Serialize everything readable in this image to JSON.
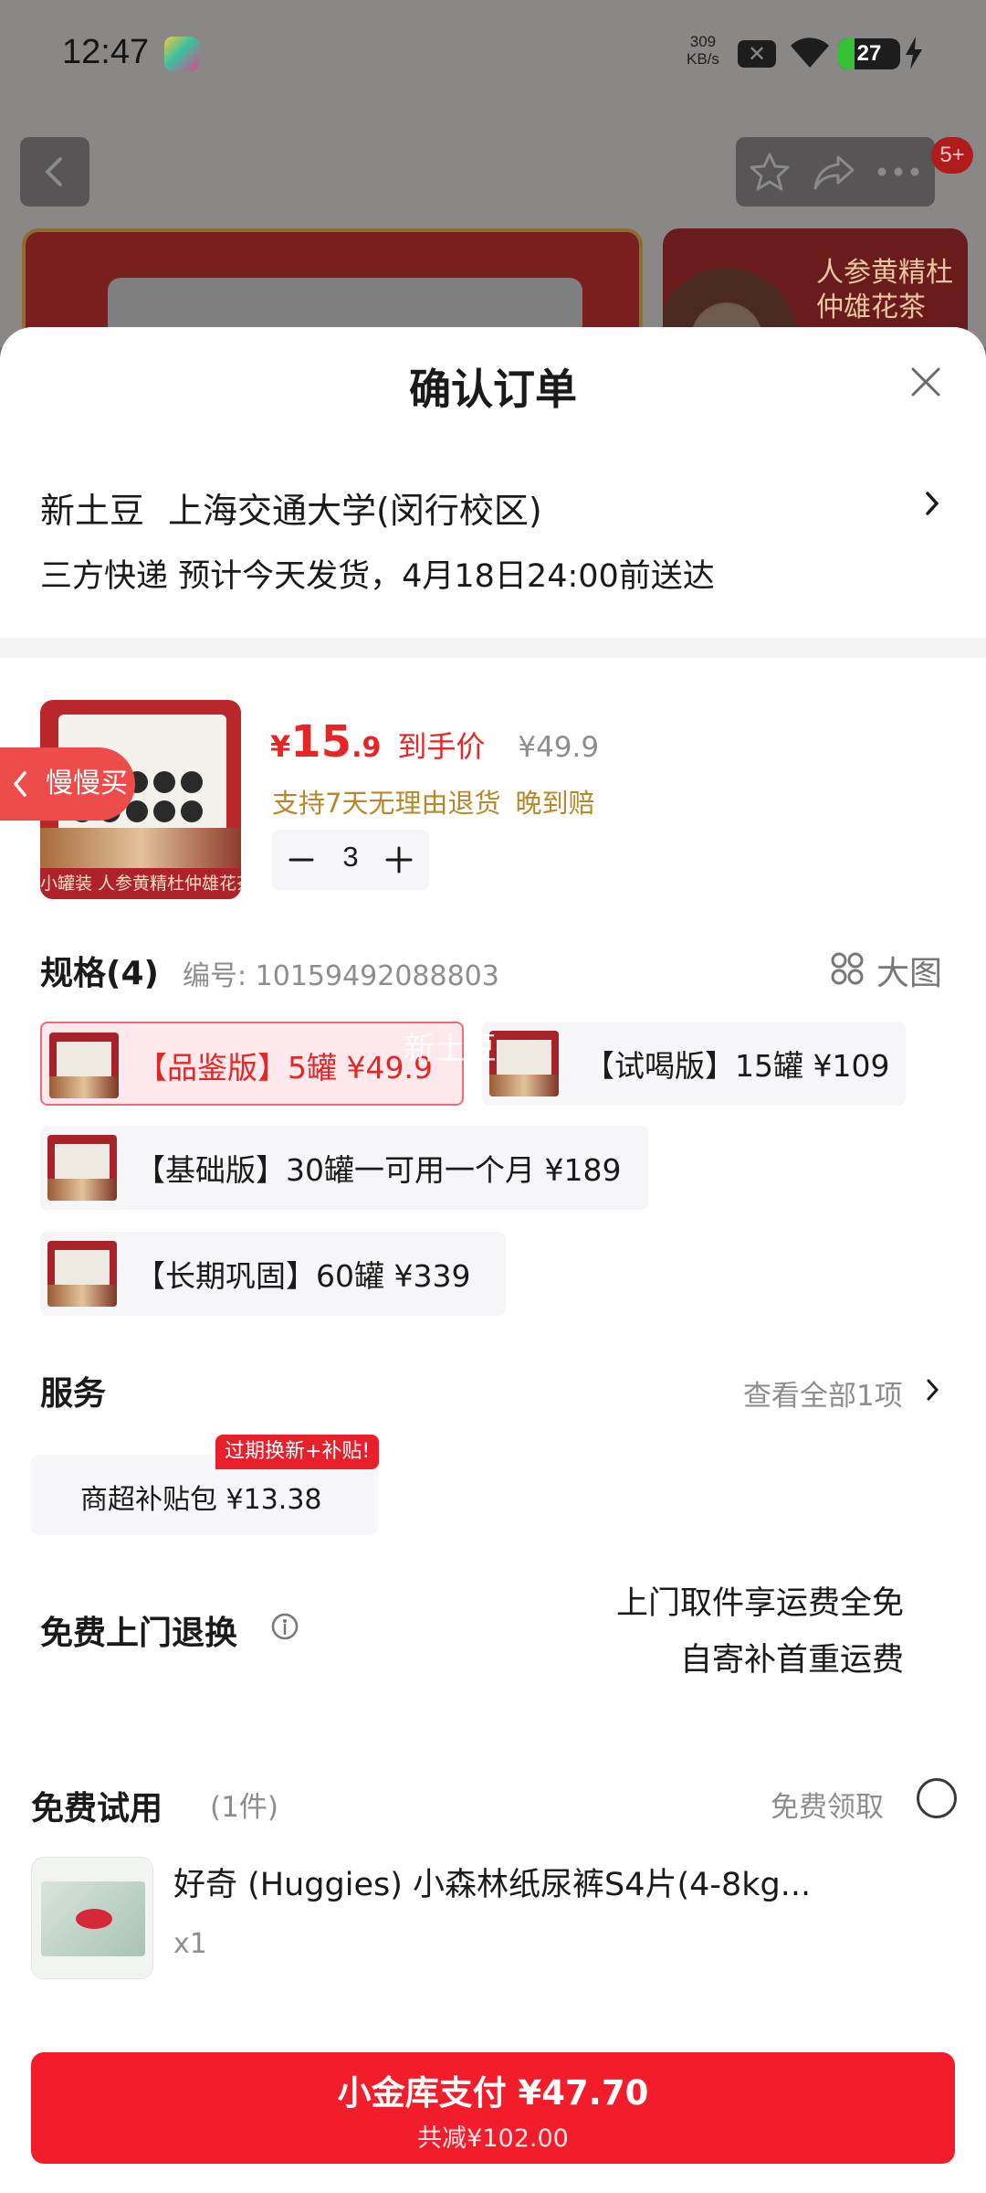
{
  "status_bar": {
    "time": "12:47",
    "net_speed_value": "309",
    "net_speed_unit": "KB/s",
    "battery_percent": "27",
    "battery_level": 0.27
  },
  "background": {
    "notification_badge": "5+",
    "banner_text": "人参黄精杜仲雄花茶"
  },
  "sheet": {
    "title": "确认订单"
  },
  "address": {
    "name": "新土豆",
    "location": "上海交通大学(闵行校区)",
    "shipping": "三方快递 预计今天发货，4月18日24:00前送达"
  },
  "product": {
    "image_label": "小罐装 人参黄精杜仲雄花茶",
    "slow_buy": "慢慢买",
    "price_currency": "¥",
    "price_int": "15",
    "price_dec": ".9",
    "price_tag": "到手价",
    "original_price": "¥49.9",
    "promise_1": "支持7天无理由退货",
    "promise_2": "晚到赔",
    "quantity": "3"
  },
  "spec": {
    "title": "规格(4)",
    "code": "编号: 10159492088803",
    "big_image": "大图",
    "watermark": "新土豆",
    "options": [
      {
        "text": "【品鉴版】5罐  ¥49.9",
        "selected": true
      },
      {
        "text": "【试喝版】15罐  ¥109",
        "selected": false
      },
      {
        "text": "【基础版】30罐一可用一个月  ¥189",
        "selected": false
      },
      {
        "text": "【长期巩固】60罐  ¥339",
        "selected": false
      }
    ]
  },
  "service": {
    "title": "服务",
    "view_all": "查看全部1项",
    "badge": "过期换新+补贴!",
    "item": "商超补贴包  ¥13.38"
  },
  "returns": {
    "title": "免费上门退换",
    "line_1": "上门取件享运费全免",
    "line_2": "自寄补首重运费"
  },
  "trial": {
    "title": "免费试用",
    "count": "(1件)",
    "claim": "免费领取",
    "item_name": "好奇 (Huggies) 小森林纸尿裤S4片(4-8kg...",
    "item_qty": "x1"
  },
  "pay": {
    "label": "小金库支付 ¥47.70",
    "discount": "共减¥102.00"
  },
  "colors": {
    "accent_red": "#f21c2a",
    "price_red": "#e42626",
    "gold": "#b8872a"
  }
}
